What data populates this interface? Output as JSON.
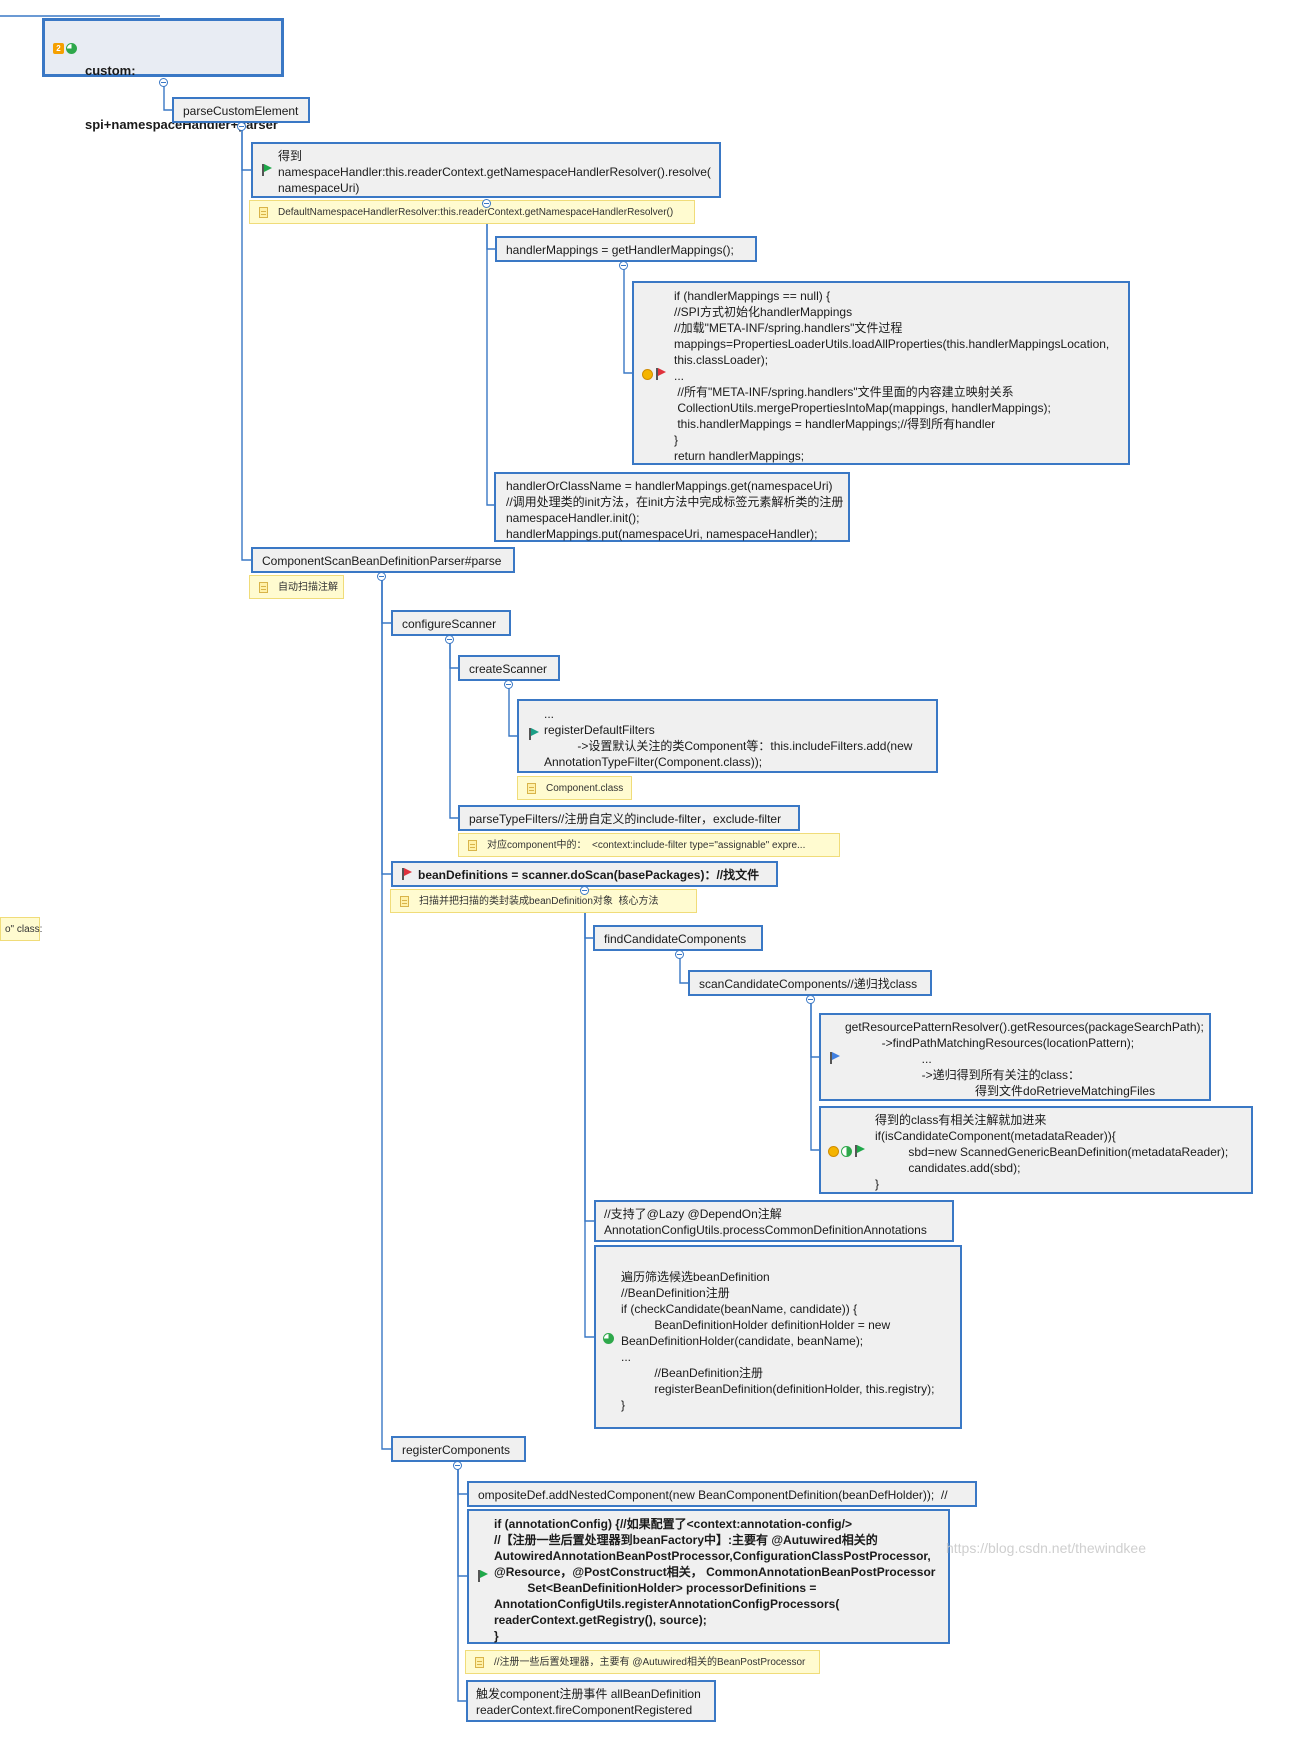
{
  "root": {
    "line1": "custom:",
    "line2": "spi+namespaceHandler+parser",
    "priority": "2"
  },
  "parse_custom_element": "parseCustomElement",
  "get_handler": {
    "text": "得到\nnamespaceHandler:this.readerContext.getNamespaceHandlerResolver().resolve(\nnamespaceUri)"
  },
  "get_handler_note": "DefaultNamespaceHandlerResolver:this.readerContext.getNamespaceHandlerResolver()",
  "handler_mappings": "handlerMappings = getHandlerMappings();",
  "handler_mappings_code": "if (handlerMappings == null) {\n//SPI方式初始化handlerMappings\n//加载\"META-INF/spring.handlers\"文件过程\nmappings=PropertiesLoaderUtils.loadAllProperties(this.handlerMappingsLocation,\nthis.classLoader);\n...\n //所有\"META-INF/spring.handlers\"文件里面的内容建立映射关系\n CollectionUtils.mergePropertiesIntoMap(mappings, handlerMappings);\n this.handlerMappings = handlerMappings;//得到所有handler\n}\nreturn handlerMappings;",
  "handler_init": "handlerOrClassName = handlerMappings.get(namespaceUri)\n//调用处理类的init方法，在init方法中完成标签元素解析类的注册\nnamespaceHandler.init();\nhandlerMappings.put(namespaceUri, namespaceHandler);",
  "component_scan_parse": "ComponentScanBeanDefinitionParser#parse",
  "component_scan_note": "自动扫描注解",
  "configure_scanner": "configureScanner",
  "create_scanner": "createScanner",
  "register_default_filters": "...\nregisterDefaultFilters\n          ->设置默认关注的类Component等：this.includeFilters.add(new\nAnnotationTypeFilter(Component.class));",
  "component_class_note": "Component.class",
  "parse_type_filters": "parseTypeFilters//注册自定义的include-filter，exclude-filter",
  "parse_type_filters_note": "对应component中的：  <context:include-filter type=\"assignable\" expre...",
  "left_edge_note": "o\" class:",
  "bean_definitions": "beanDefinitions = scanner.doScan(basePackages)：//找文件",
  "bean_definitions_note": "扫描并把扫描的类封装成beanDefinition对象  核心方法",
  "find_candidate": "findCandidateComponents",
  "scan_candidate": "scanCandidateComponents//递归找class",
  "get_resources": "getResourcePatternResolver().getResources(packageSearchPath);\n           ->findPathMatchingResources(locationPattern);\n                       ...\n                       ->递归得到所有关注的class：\n                                       得到文件doRetrieveMatchingFiles",
  "is_candidate": "得到的class有相关注解就加进来\nif(isCandidateComponent(metadataReader)){\n          sbd=new ScannedGenericBeanDefinition(metadataReader);\n          candidates.add(sbd);\n}",
  "lazy_depend": "//支持了@Lazy @DependOn注解\nAnnotationConfigUtils.processCommonDefinitionAnnotations",
  "check_candidate": "\n遍历筛选候选beanDefinition\n//BeanDefinition注册\nif (checkCandidate(beanName, candidate)) {\n          BeanDefinitionHolder definitionHolder = new\nBeanDefinitionHolder(candidate, beanName);\n...\n          //BeanDefinition注册\n          registerBeanDefinition(definitionHolder, this.registry);\n}",
  "register_components": "registerComponents",
  "composite_def": "ompositeDef.addNestedComponent(new BeanComponentDefinition(beanDefHolder));  //",
  "annotation_config": "if (annotationConfig) {//如果配置了<context:annotation-config/>\n//【注册一些后置处理器到beanFactory中】:主要有 @Autuwired相关的\nAutowiredAnnotationBeanPostProcessor,ConfigurationClassPostProcessor,\n@Resource，@PostConstruct相关， CommonAnnotationBeanPostProcessor\n          Set<BeanDefinitionHolder> processorDefinitions =\nAnnotationConfigUtils.registerAnnotationConfigProcessors(\nreaderContext.getRegistry(), source);\n}",
  "annotation_config_note": "//注册一些后置处理器，主要有 @Autuwired相关的BeanPostProcessor",
  "fire_event": "触发component注册事件 allBeanDefinition\nreaderContext.fireComponentRegistered",
  "watermark": "https://blog.csdn.net/thewindkee",
  "colors": {
    "border": "#3a78c5",
    "node_bg": "#f0f0f0",
    "note_bg": "#fffbd0",
    "flag_green": "#1fa84a",
    "flag_red": "#e0313b",
    "flag_blue": "#3f7fe0"
  }
}
